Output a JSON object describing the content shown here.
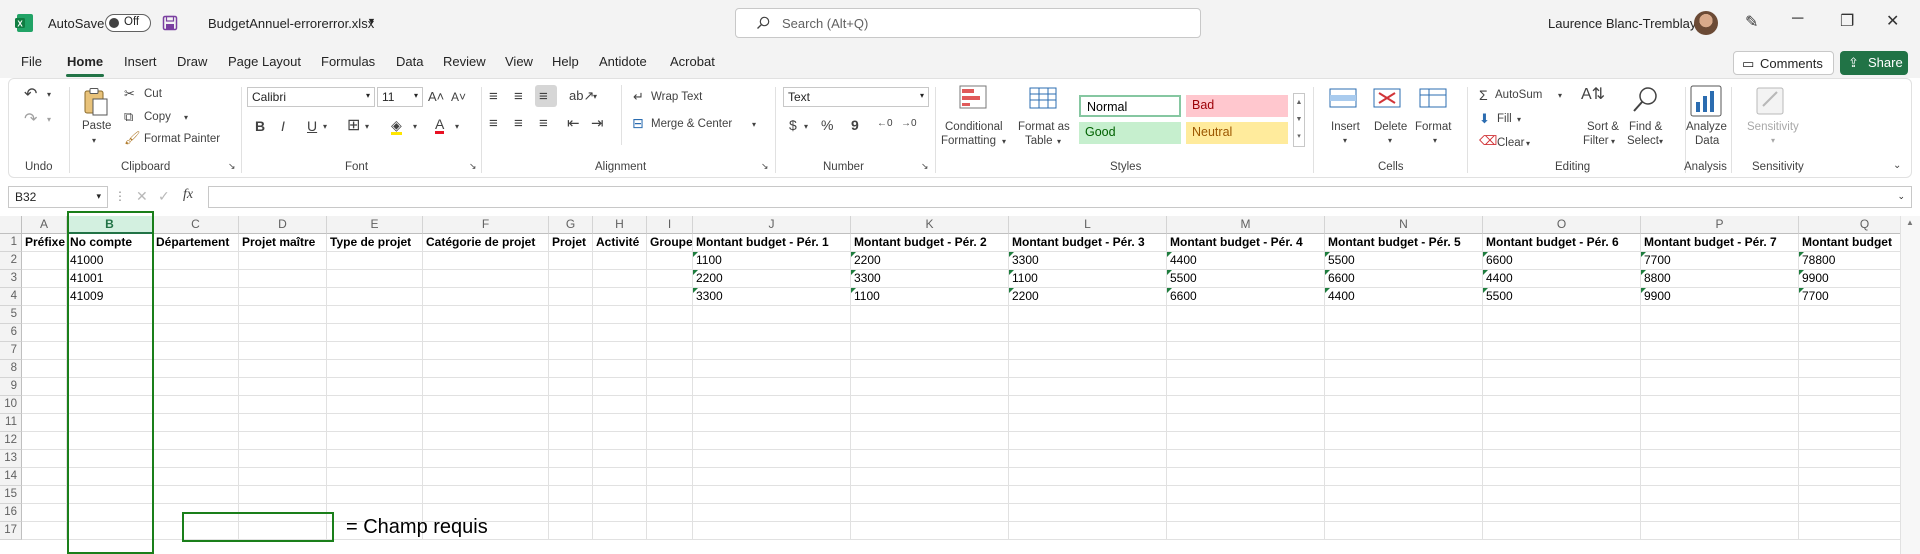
{
  "titlebar": {
    "autosave_label": "AutoSave",
    "autosave_state": "Off",
    "file_name": "BudgetAnnuel-errorerror.xlsx",
    "search_placeholder": "Search (Alt+Q)",
    "user_name": "Laurence Blanc-Tremblay"
  },
  "menu": {
    "items": [
      "File",
      "Home",
      "Insert",
      "Draw",
      "Page Layout",
      "Formulas",
      "Data",
      "Review",
      "View",
      "Help",
      "Antidote",
      "Acrobat"
    ],
    "active": "Home",
    "comments_label": "Comments",
    "share_label": "Share"
  },
  "ribbon": {
    "undo": {
      "group": "Undo"
    },
    "clipboard": {
      "group": "Clipboard",
      "paste": "Paste",
      "cut": "Cut",
      "copy": "Copy",
      "format_painter": "Format Painter"
    },
    "font": {
      "group": "Font",
      "name": "Calibri",
      "size": "11",
      "bold": "B",
      "italic": "I",
      "underline": "U"
    },
    "alignment": {
      "group": "Alignment",
      "wrap_text": "Wrap Text",
      "merge_center": "Merge & Center"
    },
    "number": {
      "group": "Number",
      "format": "Text",
      "currency": "$",
      "percent": "%",
      "comma": "9"
    },
    "styles": {
      "group": "Styles",
      "conditional_1": "Conditional",
      "conditional_2": "Formatting",
      "format_table_1": "Format as",
      "format_table_2": "Table",
      "normal": "Normal",
      "bad": "Bad",
      "good": "Good",
      "neutral": "Neutral"
    },
    "cells": {
      "group": "Cells",
      "insert": "Insert",
      "delete": "Delete",
      "format": "Format"
    },
    "editing": {
      "group": "Editing",
      "autosum": "AutoSum",
      "fill": "Fill",
      "clear": "Clear",
      "sort_1": "Sort &",
      "sort_2": "Filter",
      "find_1": "Find &",
      "find_2": "Select"
    },
    "analysis": {
      "group": "Analysis",
      "analyze_1": "Analyze",
      "analyze_2": "Data"
    },
    "sensitivity": {
      "group": "Sensitivity",
      "label": "Sensitivity"
    }
  },
  "formula_bar": {
    "name_box": "B32",
    "fx": "fx",
    "content": ""
  },
  "sheet": {
    "columns": [
      "A",
      "B",
      "C",
      "D",
      "E",
      "F",
      "G",
      "H",
      "I",
      "J",
      "K",
      "L",
      "M",
      "N",
      "O",
      "P",
      "Q"
    ],
    "selected_column": "B",
    "rows": [
      "1",
      "2",
      "3",
      "4",
      "5",
      "6",
      "7",
      "8",
      "9",
      "10",
      "11",
      "12",
      "13",
      "14",
      "15",
      "16",
      "17"
    ],
    "header_row": [
      "Préfixe",
      "No compte",
      "Département",
      "Projet maître",
      "Type de projet",
      "Catégorie de projet",
      "Projet",
      "Activité",
      "Groupe",
      "Montant budget - Pér. 1",
      "Montant budget - Pér. 2",
      "Montant budget - Pér. 3",
      "Montant budget - Pér. 4",
      "Montant budget - Pér. 5",
      "Montant budget - Pér. 6",
      "Montant budget - Pér. 7",
      "Montant budget"
    ],
    "data_rows": [
      [
        "",
        "41000",
        "",
        "",
        "",
        "",
        "",
        "",
        "",
        "1100",
        "2200",
        "3300",
        "4400",
        "5500",
        "6600",
        "7700",
        "78800"
      ],
      [
        "",
        "41001",
        "",
        "",
        "",
        "",
        "",
        "",
        "",
        "2200",
        "3300",
        "1100",
        "5500",
        "6600",
        "4400",
        "8800",
        "9900"
      ],
      [
        "",
        "41009",
        "",
        "",
        "",
        "",
        "",
        "",
        "",
        "3300",
        "1100",
        "2200",
        "6600",
        "4400",
        "5500",
        "9900",
        "7700"
      ]
    ],
    "legend_text": "= Champ requis",
    "accent_color": "#217346",
    "required_border_color": "#1a7f1a"
  }
}
